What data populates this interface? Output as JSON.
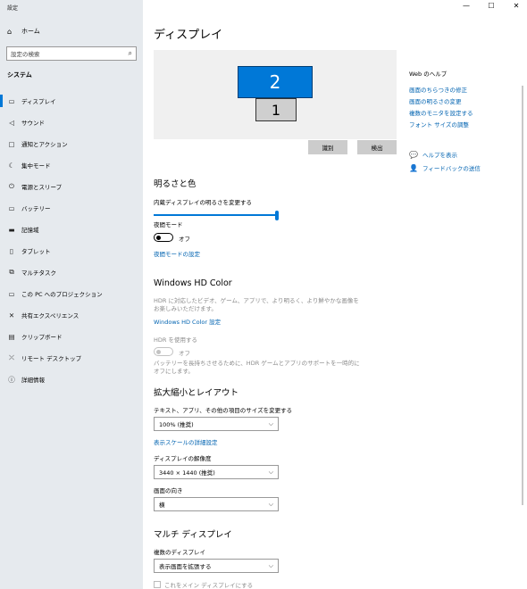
{
  "window": {
    "title": "設定",
    "minimize": "—",
    "maximize": "☐",
    "close": "✕"
  },
  "sidebar": {
    "home_label": "ホーム",
    "search_placeholder": "設定の検索",
    "section_heading": "システム",
    "items": [
      {
        "label": "ディスプレイ",
        "icon": "display-icon"
      },
      {
        "label": "サウンド",
        "icon": "sound-icon"
      },
      {
        "label": "通知とアクション",
        "icon": "notification-icon"
      },
      {
        "label": "集中モード",
        "icon": "focus-icon"
      },
      {
        "label": "電源とスリープ",
        "icon": "power-icon"
      },
      {
        "label": "バッテリー",
        "icon": "battery-icon"
      },
      {
        "label": "記憶域",
        "icon": "storage-icon"
      },
      {
        "label": "タブレット",
        "icon": "tablet-icon"
      },
      {
        "label": "マルチタスク",
        "icon": "multitask-icon"
      },
      {
        "label": "この PC へのプロジェクション",
        "icon": "projection-icon"
      },
      {
        "label": "共有エクスペリエンス",
        "icon": "shared-icon"
      },
      {
        "label": "クリップボード",
        "icon": "clipboard-icon"
      },
      {
        "label": "リモート デスクトップ",
        "icon": "remote-icon"
      },
      {
        "label": "詳細情報",
        "icon": "info-icon"
      }
    ]
  },
  "main": {
    "title": "ディスプレイ",
    "monitors": {
      "primary": "2",
      "secondary": "1"
    },
    "identify_button": "識別",
    "detect_button": "検出",
    "brightness": {
      "heading": "明るさと色",
      "slider_label": "内蔵ディスプレイの明るさを変更する",
      "slider_value": 1.0,
      "night_mode_label": "夜間モード",
      "night_mode_state": "オフ",
      "night_mode_link": "夜間モードの設定"
    },
    "hdr": {
      "heading": "Windows HD Color",
      "description": "HDR に対応したビデオ、ゲーム、アプリで、より明るく、より鮮やかな画像をお楽しみいただけます。",
      "settings_link": "Windows HD Color 設定",
      "use_hdr_label": "HDR を使用する",
      "use_hdr_state": "オフ",
      "battery_note": "バッテリーを長持ちさせるために、HDR ゲームとアプリのサポートを一時的にオフにします。"
    },
    "scale": {
      "heading": "拡大縮小とレイアウト",
      "size_label": "テキスト、アプリ、その他の項目のサイズを変更する",
      "size_value": "100% (推奨)",
      "advanced_link": "表示スケールの詳細設定",
      "resolution_label": "ディスプレイの解像度",
      "resolution_value": "3440 × 1440 (推奨)",
      "orientation_label": "画面の向き",
      "orientation_value": "横"
    },
    "multi": {
      "heading": "マルチ ディスプレイ",
      "multiple_label": "複数のディスプレイ",
      "multiple_value": "表示画面を拡張する",
      "make_main_label": "これをメイン ディスプレイにする"
    }
  },
  "help": {
    "title": "Web のヘルプ",
    "links": [
      "画面のちらつきの修正",
      "画面の明るさの変更",
      "複数のモニタを設定する",
      "フォント サイズの調整"
    ],
    "get_help": "ヘルプを表示",
    "feedback": "フィードバックの送信"
  },
  "colors": {
    "accent": "#0078d7",
    "link": "#0063b1",
    "sidebar_bg": "#e6eaee"
  }
}
